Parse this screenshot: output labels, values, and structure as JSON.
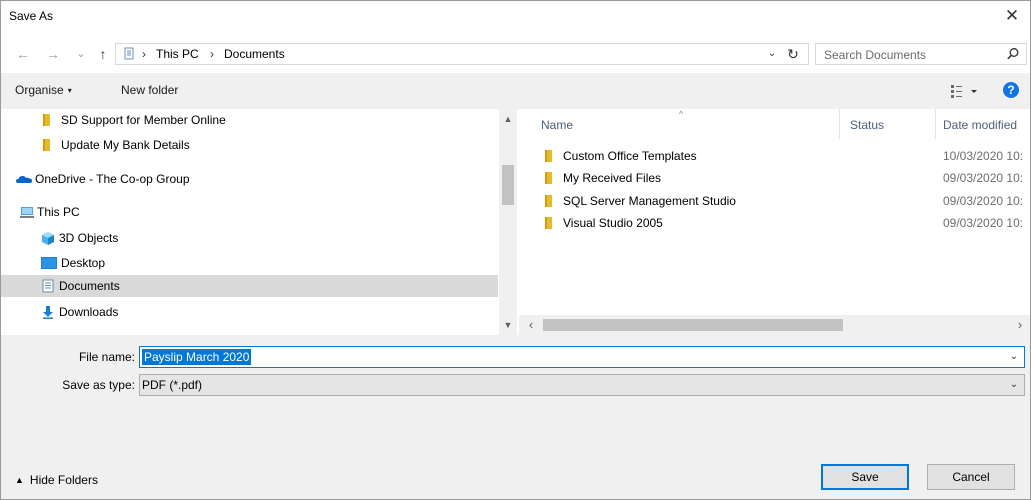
{
  "window": {
    "title": "Save As",
    "close_symbol": "✕"
  },
  "nav_buttons": {
    "back_symbol": "←",
    "forward_symbol": "→",
    "recent_symbol": "⌄",
    "up_symbol": "↑"
  },
  "address": {
    "icon": "this-pc-icon",
    "separator": "›",
    "crumbs": [
      "This PC",
      "Documents"
    ],
    "dropdown_symbol": "⌄",
    "refresh_symbol": "↻"
  },
  "search": {
    "placeholder": "Search Documents",
    "icon": "search-icon"
  },
  "toolbar": {
    "organise_label": "Organise",
    "organise_caret": "▾",
    "new_folder_label": "New folder",
    "help_label": "?"
  },
  "nav_pane": {
    "items": [
      {
        "label": "SD Support for Member Online",
        "icon": "folder-icon"
      },
      {
        "label": "Update My Bank Details",
        "icon": "folder-icon"
      },
      {
        "label": "OneDrive - The Co-op Group",
        "icon": "onedrive-icon"
      },
      {
        "label": "This PC",
        "icon": "this-pc-icon"
      },
      {
        "label": "3D Objects",
        "icon": "3d-objects-icon"
      },
      {
        "label": "Desktop",
        "icon": "desktop-icon"
      },
      {
        "label": "Documents",
        "icon": "documents-icon",
        "selected": true
      },
      {
        "label": "Downloads",
        "icon": "downloads-icon"
      }
    ],
    "scroll_up_symbol": "▲",
    "scroll_down_symbol": "▼"
  },
  "file_list": {
    "columns": {
      "name": "Name",
      "status": "Status",
      "date_modified": "Date modified"
    },
    "sort_symbol": "^",
    "rows": [
      {
        "name": "Custom Office Templates",
        "date": "10/03/2020 10:"
      },
      {
        "name": "My Received Files",
        "date": "09/03/2020 10:"
      },
      {
        "name": "SQL Server Management Studio",
        "date": "09/03/2020 10:"
      },
      {
        "name": "Visual Studio 2005",
        "date": "09/03/2020 10:"
      }
    ],
    "scroll_left_symbol": "‹",
    "scroll_right_symbol": "›"
  },
  "form": {
    "file_name_label": "File name:",
    "file_name_value": "Payslip March 2020",
    "save_type_label": "Save as type:",
    "save_type_value": "PDF (*.pdf)",
    "dropdown_symbol": "⌄"
  },
  "footer": {
    "hide_folders_label": "Hide Folders",
    "hide_folders_symbol": "▲",
    "save_label": "Save",
    "cancel_label": "Cancel"
  },
  "colors": {
    "accent": "#0078d7",
    "folder": "#e8b92a",
    "selection_bg": "#d9d9d9"
  }
}
